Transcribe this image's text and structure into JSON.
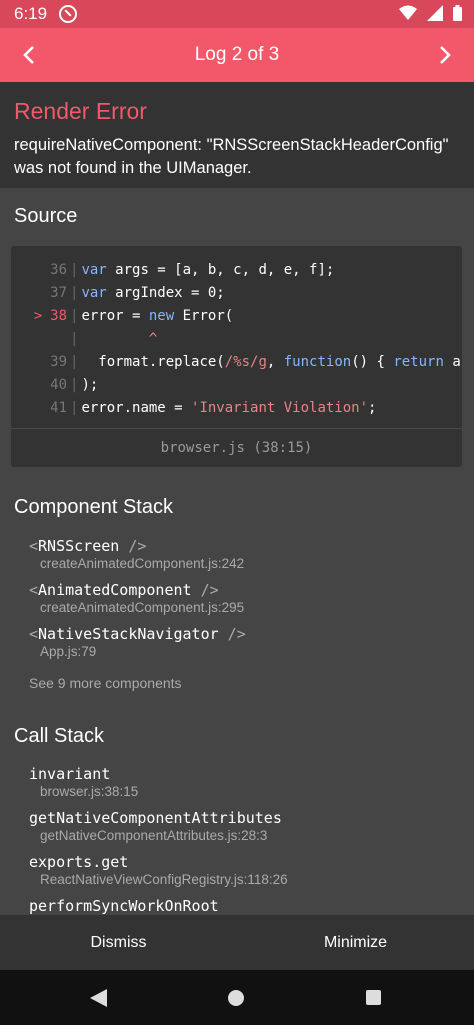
{
  "status": {
    "time": "6:19"
  },
  "header": {
    "title": "Log 2 of 3"
  },
  "error": {
    "title": "Render Error",
    "message": "requireNativeComponent: \"RNSScreenStackHeaderConfig\" was not found in the UIManager."
  },
  "source": {
    "title": "Source",
    "lines": [
      {
        "num": "36",
        "marker": "",
        "code": [
          [
            "kw",
            "var"
          ],
          [
            "plain",
            " args = [a, b, c, d, e, f];"
          ]
        ]
      },
      {
        "num": "37",
        "marker": "",
        "code": [
          [
            "kw",
            "var"
          ],
          [
            "plain",
            " argIndex = 0;"
          ]
        ]
      },
      {
        "num": "38",
        "marker": ">",
        "code": [
          [
            "plain",
            "error = "
          ],
          [
            "kw",
            "new"
          ],
          [
            "plain",
            " Error("
          ]
        ]
      },
      {
        "num": "",
        "marker": "",
        "code": [
          [
            "str",
            "        ^"
          ]
        ]
      },
      {
        "num": "39",
        "marker": "",
        "code": [
          [
            "plain",
            "  format.replace("
          ],
          [
            "str",
            "/%s/g"
          ],
          [
            "plain",
            ", "
          ],
          [
            "kw",
            "function"
          ],
          [
            "plain",
            "() { "
          ],
          [
            "kw",
            "return"
          ],
          [
            "plain",
            " a"
          ]
        ]
      },
      {
        "num": "40",
        "marker": "",
        "code": [
          [
            "plain",
            ");"
          ]
        ]
      },
      {
        "num": "41",
        "marker": "",
        "code": [
          [
            "plain",
            "error.name = "
          ],
          [
            "str",
            "'Invariant Violation'"
          ],
          [
            "plain",
            ";"
          ]
        ]
      }
    ],
    "file": "browser.js (38:15)"
  },
  "component_stack": {
    "title": "Component Stack",
    "items": [
      {
        "name": "RNSScreen",
        "file": "createAnimatedComponent.js:242"
      },
      {
        "name": "AnimatedComponent",
        "file": "createAnimatedComponent.js:295"
      },
      {
        "name": "NativeStackNavigator",
        "file": "App.js:79"
      }
    ],
    "see_more": "See 9 more components"
  },
  "call_stack": {
    "title": "Call Stack",
    "items": [
      {
        "name": "invariant",
        "file": "browser.js:38:15"
      },
      {
        "name": "getNativeComponentAttributes",
        "file": "getNativeComponentAttributes.js:28:3"
      },
      {
        "name": "exports.get",
        "file": "ReactNativeViewConfigRegistry.js:118:26"
      },
      {
        "name": "performSyncWorkOnRoot",
        "file": ""
      }
    ]
  },
  "footer": {
    "dismiss": "Dismiss",
    "minimize": "Minimize"
  },
  "colors": {
    "header": "#f2586a",
    "status_bar": "#d8475a",
    "error_title": "#f2586a",
    "keyword": "#85b6ff",
    "string": "#e88387"
  }
}
